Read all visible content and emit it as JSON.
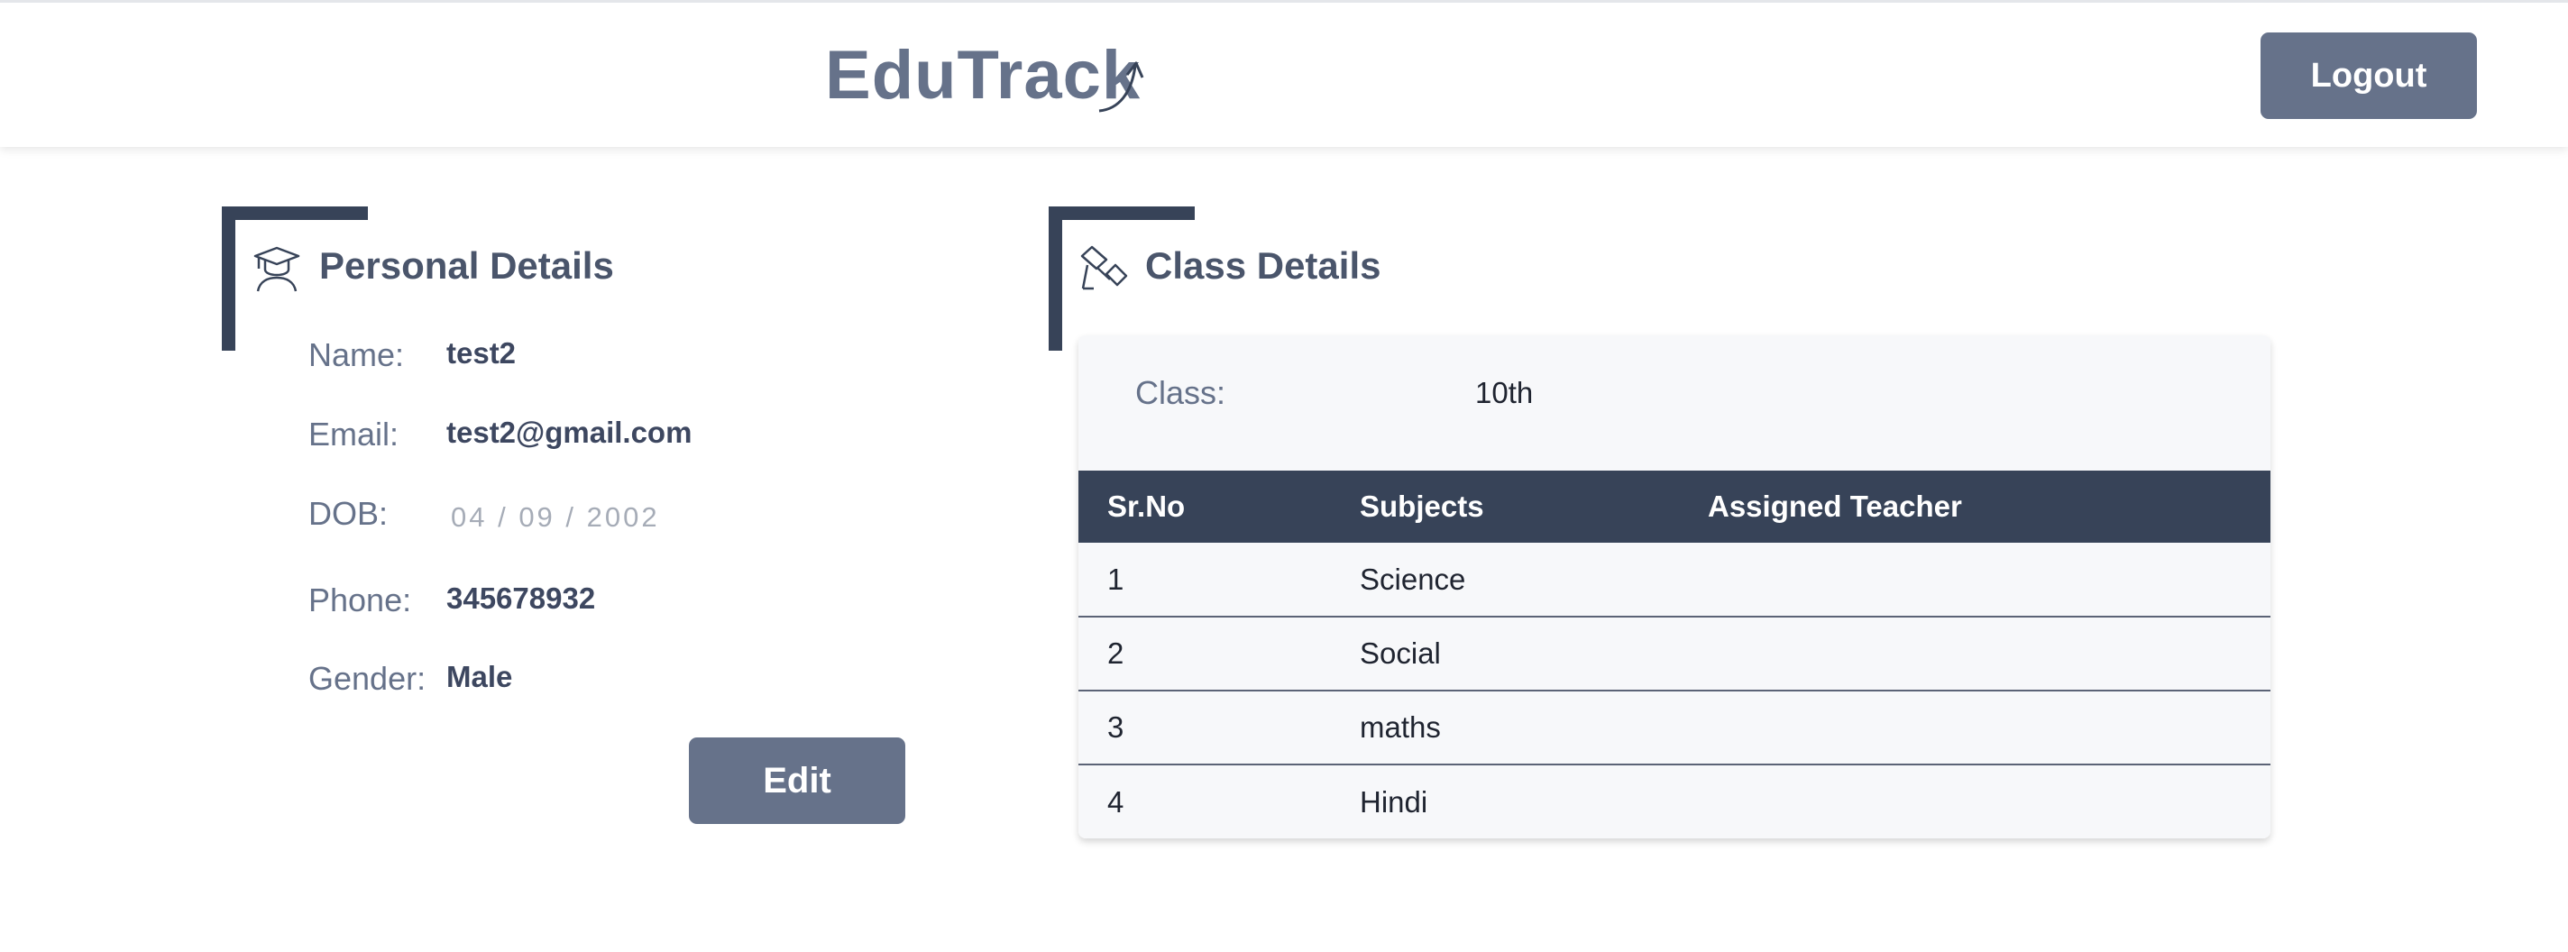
{
  "header": {
    "logo_text": "EduTrack",
    "logout_label": "Logout"
  },
  "personal": {
    "title": "Personal Details",
    "icon": "graduate-icon",
    "fields": [
      {
        "label": "Name:",
        "value": "test2"
      },
      {
        "label": "Email:",
        "value": "test2@gmail.com"
      },
      {
        "label": "DOB:",
        "value": "04 / 09 / 2002"
      },
      {
        "label": "Phone:",
        "value": "345678932"
      },
      {
        "label": "Gender:",
        "value": "Male"
      }
    ],
    "edit_label": "Edit"
  },
  "class_details": {
    "title": "Class Details",
    "icon": "telescope-icon",
    "class_label": "Class:",
    "class_value": "10th",
    "table": {
      "headers": [
        "Sr.No",
        "Subjects",
        "Assigned Teacher"
      ],
      "rows": [
        [
          "1",
          "Science",
          ""
        ],
        [
          "2",
          "Social",
          ""
        ],
        [
          "3",
          "maths",
          ""
        ],
        [
          "4",
          "Hindi",
          ""
        ]
      ]
    }
  },
  "colors": {
    "primary_button": "#66728a",
    "dark_accent": "#374358",
    "card_background": "#f7f8fa"
  }
}
